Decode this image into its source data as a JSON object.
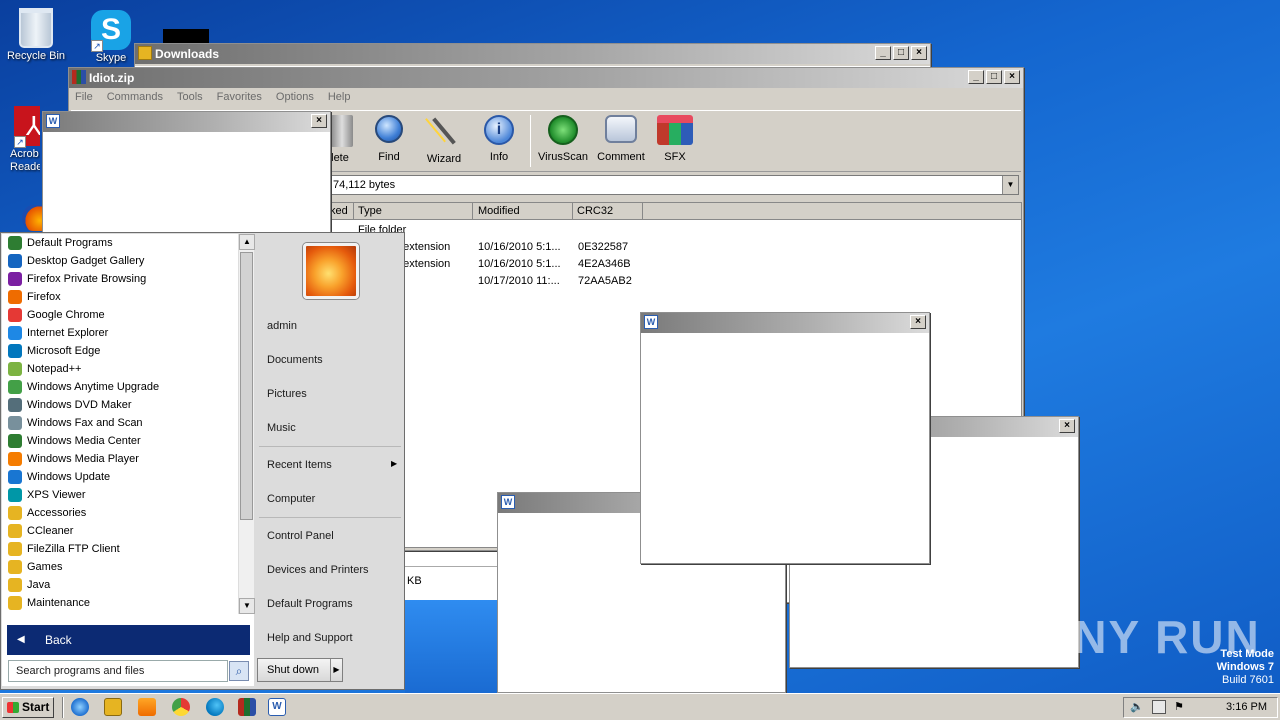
{
  "desktop": {
    "icons": [
      {
        "label": "Recycle Bin"
      },
      {
        "label": "Skype"
      },
      {
        "label": "Acrob\nReade"
      }
    ]
  },
  "downloads_window": {
    "title": "Downloads"
  },
  "winrar": {
    "title": "Idiot.zip",
    "menu": [
      "File",
      "Commands",
      "Tools",
      "Favorites",
      "Options",
      "Help"
    ],
    "toolbar": [
      {
        "label": "lete",
        "icon": "delete-icon"
      },
      {
        "label": "Find",
        "icon": "find-icon"
      },
      {
        "label": "Wizard",
        "icon": "wizard-icon"
      },
      {
        "label": "Info",
        "icon": "info-icon"
      },
      {
        "label": "VirusScan",
        "icon": "virusscan-icon"
      },
      {
        "label": "Comment",
        "icon": "comment-icon"
      },
      {
        "label": "SFX",
        "icon": "sfx-icon"
      }
    ],
    "path_text": "74,112 bytes",
    "columns": [
      "ked",
      "Type",
      "Modified",
      "CRC32"
    ],
    "rows": [
      {
        "type": "File folder",
        "modified": "",
        "crc": ""
      },
      {
        "type": "n extension",
        "modified": "10/16/2010 5:1...",
        "crc": "0E322587"
      },
      {
        "type": "n extension",
        "modified": "10/16/2010 5:1...",
        "crc": "4E2A346B"
      },
      {
        "type": "n",
        "modified": "10/17/2010 11:...",
        "crc": "72AA5AB2"
      }
    ],
    "status_fragment": "KB"
  },
  "start_menu": {
    "programs": [
      {
        "label": "Default Programs",
        "color": "#2e7d32"
      },
      {
        "label": "Desktop Gadget Gallery",
        "color": "#1565c0"
      },
      {
        "label": "Firefox Private Browsing",
        "color": "#7b1fa2"
      },
      {
        "label": "Firefox",
        "color": "#ef6c00"
      },
      {
        "label": "Google Chrome",
        "color": "#e53935"
      },
      {
        "label": "Internet Explorer",
        "color": "#1e88e5"
      },
      {
        "label": "Microsoft Edge",
        "color": "#0277bd"
      },
      {
        "label": "Notepad++",
        "color": "#7cb342"
      },
      {
        "label": "Windows Anytime Upgrade",
        "color": "#43a047"
      },
      {
        "label": "Windows DVD Maker",
        "color": "#546e7a"
      },
      {
        "label": "Windows Fax and Scan",
        "color": "#78909c"
      },
      {
        "label": "Windows Media Center",
        "color": "#2e7d32"
      },
      {
        "label": "Windows Media Player",
        "color": "#f57c00"
      },
      {
        "label": "Windows Update",
        "color": "#1976d2"
      },
      {
        "label": "XPS Viewer",
        "color": "#0097a7"
      },
      {
        "label": "Accessories",
        "color": "#e6b422"
      },
      {
        "label": "CCleaner",
        "color": "#e6b422"
      },
      {
        "label": "FileZilla FTP Client",
        "color": "#e6b422"
      },
      {
        "label": "Games",
        "color": "#e6b422"
      },
      {
        "label": "Java",
        "color": "#e6b422"
      },
      {
        "label": "Maintenance",
        "color": "#e6b422"
      }
    ],
    "back_label": "Back",
    "search_placeholder": "Search programs and files",
    "right_links": [
      "admin",
      "Documents",
      "Pictures",
      "Music",
      "Recent Items",
      "Computer",
      "Control Panel",
      "Devices and Printers",
      "Default Programs",
      "Help and Support"
    ],
    "shutdown_label": "Shut down"
  },
  "taskbar": {
    "start_label": "Start",
    "clock": "3:16 PM"
  },
  "watermark": {
    "line1": "Test Mode",
    "line2": "Windows 7",
    "line3": "Build 7601",
    "brand": "ANY RUN"
  }
}
